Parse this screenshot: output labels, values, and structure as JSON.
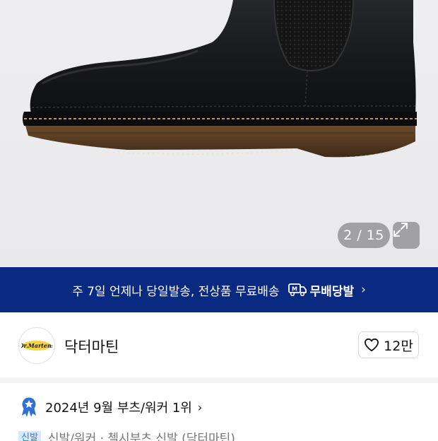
{
  "gallery": {
    "counter": "2 / 15",
    "expand_icon": "expand-arrows-icon"
  },
  "banner": {
    "text": "주 7일 언제나 당일발송, 전상품 무료배송",
    "brand": "무배당발",
    "brand_icon": "m-truck-icon",
    "chevron": "›",
    "bg_color": "#0a2a82"
  },
  "seller": {
    "name": "닥터마틴",
    "like_count": "12만",
    "heart_icon": "heart-outline-icon"
  },
  "ranking": {
    "text": "2024년 9월 부츠/워커 1위",
    "chevron": "›",
    "icon": "award-star-icon"
  },
  "partial_row": {
    "tag": "신발",
    "text": "신발/워커 · 첼시부츠 신발 (닥터마틴)"
  }
}
